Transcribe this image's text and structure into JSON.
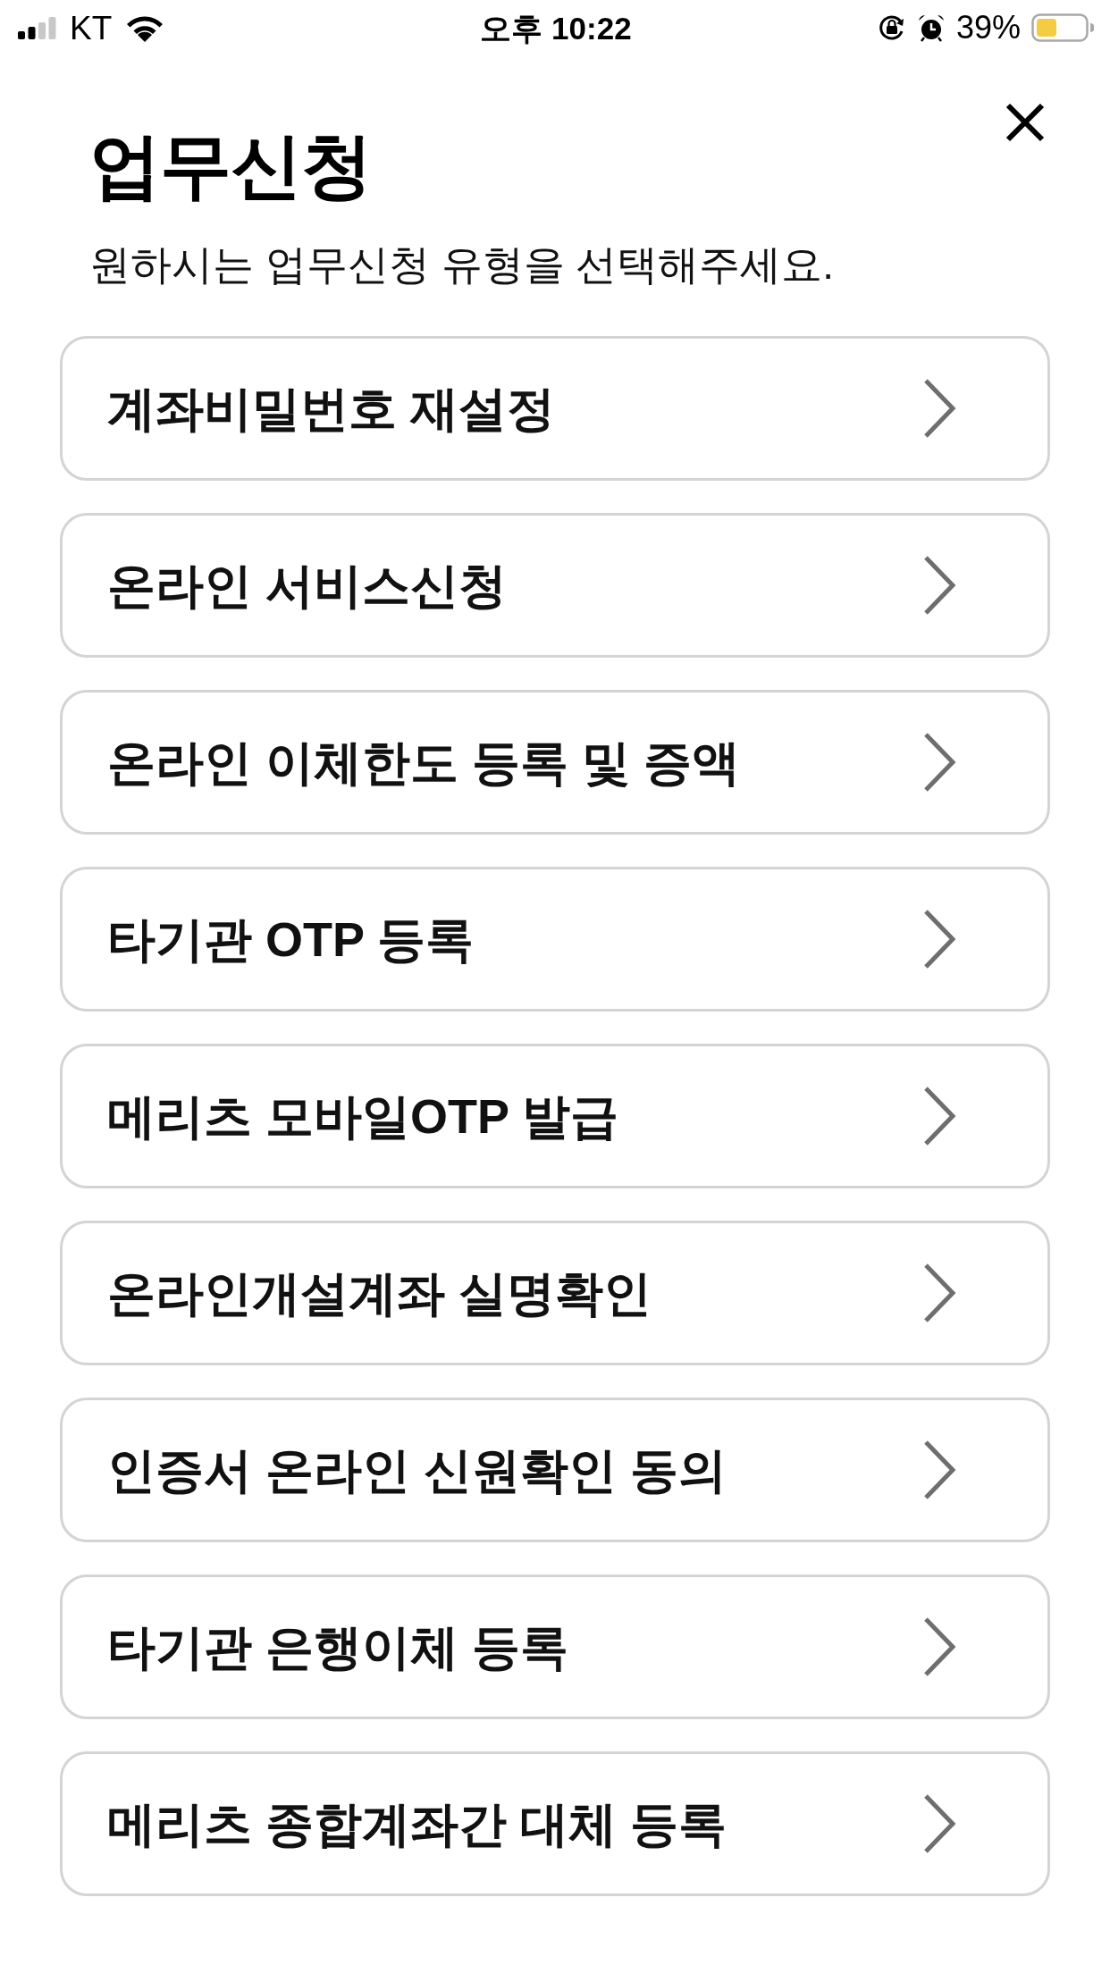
{
  "status_bar": {
    "carrier": "KT",
    "time": "오후 10:22",
    "battery": "39%"
  },
  "header": {
    "title": "업무신청",
    "subtitle": "원하시는 업무신청 유형을 선택해주세요."
  },
  "items": [
    {
      "label": "계좌비밀번호 재설정"
    },
    {
      "label": "온라인 서비스신청"
    },
    {
      "label": "온라인 이체한도 등록 및 증액"
    },
    {
      "label": "타기관 OTP 등록"
    },
    {
      "label": "메리츠 모바일OTP 발급"
    },
    {
      "label": "온라인개설계좌 실명확인"
    },
    {
      "label": "인증서 온라인 신원확인 동의"
    },
    {
      "label": "타기관 은행이체 등록"
    },
    {
      "label": "메리츠 종합계좌간 대체 등록"
    }
  ]
}
